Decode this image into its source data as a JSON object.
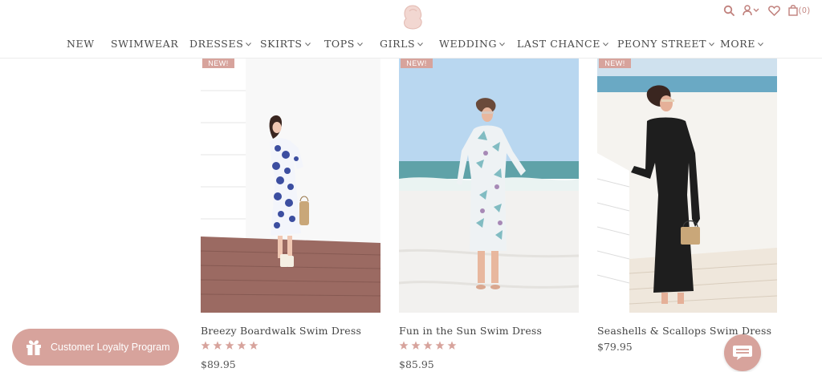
{
  "header": {
    "cart_count": "(0)"
  },
  "nav": {
    "items": [
      {
        "label": "NEW",
        "has_dropdown": false
      },
      {
        "label": "SWIMWEAR",
        "has_dropdown": false
      },
      {
        "label": "DRESSES",
        "has_dropdown": true
      },
      {
        "label": "SKIRTS",
        "has_dropdown": true
      },
      {
        "label": "TOPS",
        "has_dropdown": true
      },
      {
        "label": "GIRLS",
        "has_dropdown": true
      },
      {
        "label": "WEDDING",
        "has_dropdown": true
      },
      {
        "label": "LAST CHANCE",
        "has_dropdown": true
      },
      {
        "label": "PEONY STREET",
        "has_dropdown": true
      },
      {
        "label": "MORE",
        "has_dropdown": true
      }
    ]
  },
  "products": [
    {
      "badge": "NEW!",
      "name": "Breezy Boardwalk Swim Dress",
      "rating": 5,
      "price": "$89.95"
    },
    {
      "badge": "NEW!",
      "name": "Fun in the Sun Swim Dress",
      "rating": 5,
      "price": "$85.95"
    },
    {
      "badge": "NEW!",
      "name": "Seashells & Scallops Swim Dress",
      "rating": null,
      "price": "$79.95"
    }
  ],
  "loyalty": {
    "label": "Customer Loyalty Program"
  },
  "colors": {
    "accent": "#d7a39c",
    "icon": "#c0807c",
    "text": "#4a4a4a"
  },
  "icons": [
    "logo-icon",
    "search-icon",
    "account-icon",
    "heart-icon",
    "bag-icon",
    "chevron-down-icon",
    "gift-icon",
    "chat-icon",
    "star-icon"
  ]
}
